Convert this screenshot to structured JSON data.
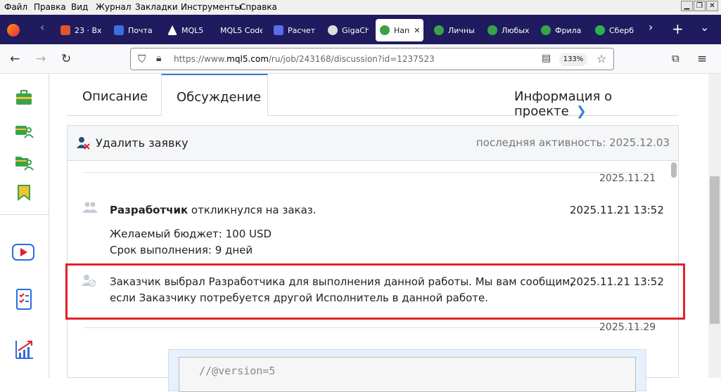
{
  "menu": [
    "Файл",
    "Правка",
    "Вид",
    "Журнал",
    "Закладки",
    "Инструменты",
    "Справка"
  ],
  "tabs": [
    {
      "label": "23 · Вх",
      "color": "#e0552b"
    },
    {
      "label": "Почта",
      "color": "#3d6fdc"
    },
    {
      "label": "MQL5",
      "color": "#fff"
    },
    {
      "label": "MQL5 Code",
      "color": "#1f1b5e"
    },
    {
      "label": "Расчет",
      "color": "#5a6de8"
    },
    {
      "label": "GigaCh",
      "color": "#ddd"
    },
    {
      "label": "Нап",
      "color": "#3aa34a",
      "active": true
    },
    {
      "label": "Личны",
      "color": "#3aa34a"
    },
    {
      "label": "Любых",
      "color": "#3aa34a"
    },
    {
      "label": "Фрила",
      "color": "#3aa34a"
    },
    {
      "label": "Сберб",
      "color": "#2bb24c"
    }
  ],
  "url": {
    "prefix": "https://www.",
    "domain": "mql5.com",
    "path": "/ru/job/243168/discussion?id=1237523"
  },
  "zoom": "133%",
  "page_tabs": {
    "description": "Описание",
    "discussion": "Обсуждение",
    "project_info": "Информация о проекте"
  },
  "panel": {
    "delete_label": "Удалить заявку",
    "last_activity": "последняя активность: 2025.12.03"
  },
  "feed": {
    "date1": "2025.11.21",
    "msg1_bold": "Разработчик",
    "msg1_rest": " откликнулся на заказ.",
    "msg1_time": "2025.11.21 13:52",
    "budget": "Желаемый бюджет: 100 USD",
    "deadline": "Срок выполнения: 9 дней",
    "msg2_line1": "Заказчик выбрал Разработчика для выполнения данной работы. Мы вам сообщим,",
    "msg2_line2": "если Заказчику потребуется другой Исполнитель в данной работе.",
    "msg2_time": "2025.11.21 13:52",
    "date2": "2025.11.29",
    "code": "//@version=5"
  },
  "colors": {
    "accent": "#3b7dd8",
    "highlight": "#e0212b",
    "sidebar_icon": "#3aa34a"
  }
}
